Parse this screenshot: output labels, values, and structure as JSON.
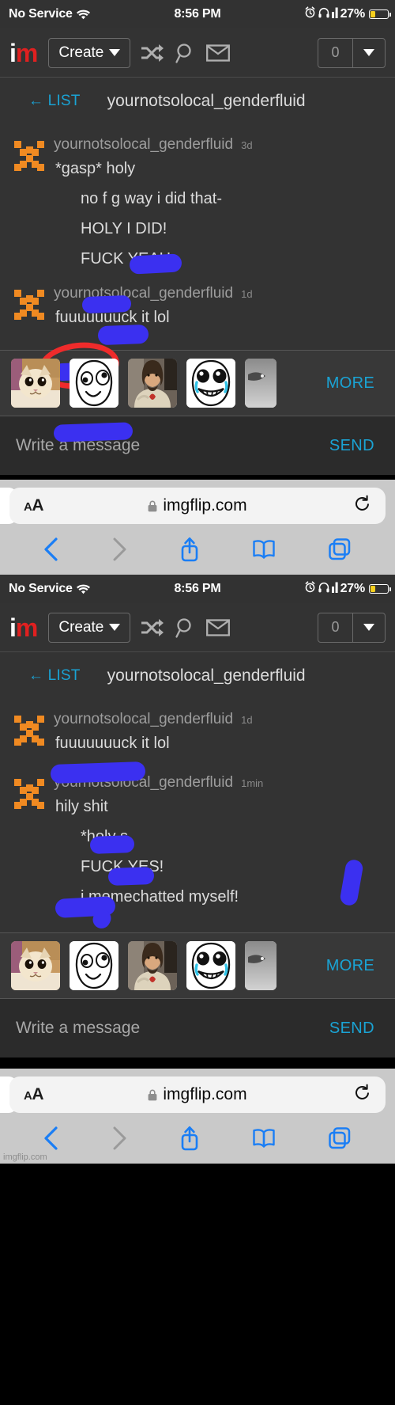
{
  "status_bar": {
    "carrier": "No Service",
    "wifi_icon": "wifi-icon",
    "time": "8:56 PM",
    "alarm_icon": "alarm-clock-icon",
    "headphones_icon": "headphones-icon",
    "signal_icon": "signal-bars-icon",
    "battery_percent": "27%",
    "battery_fill_ratio": 0.27,
    "battery_color": "#f5cf1e"
  },
  "site_nav": {
    "logo_first": "i",
    "logo_second": "m",
    "logo_color_first": "#ffffff",
    "logo_color_second": "#e02020",
    "create_label": "Create",
    "shuffle_icon": "shuffle-icon",
    "search_icon": "search-icon",
    "mail_icon": "envelope-icon",
    "notification_count": "0",
    "dropdown_icon": "chevron-down-icon"
  },
  "chat": {
    "back_label": "← LIST",
    "title": "yournotsolocal_genderfluid",
    "accent_link": "#1aa3d4",
    "avatar_color": "#f08a22",
    "censor_color": "#3b30f0",
    "annotation_color": "#ef2b2b"
  },
  "panel_one": {
    "groups": [
      {
        "user": "yournotsolocal_genderfluid",
        "time": "3d",
        "lines": [
          {
            "text": "*gasp* holy",
            "indent": false,
            "censored": true
          },
          {
            "text": "no f        g way i did that-",
            "indent": true,
            "censored": true
          },
          {
            "text": "HOLY         I DID!",
            "indent": true,
            "censored": true
          },
          {
            "text": "FUCK YEAH",
            "indent": true,
            "censored": true,
            "circled": true
          }
        ]
      },
      {
        "user": "yournotsolocal_genderfluid",
        "time": "1d",
        "lines": [
          {
            "text": "fuuuuuuuck it lol",
            "indent": false,
            "censored": true
          }
        ]
      }
    ]
  },
  "panel_two": {
    "groups": [
      {
        "user": "yournotsolocal_genderfluid",
        "time": "1d",
        "lines": [
          {
            "text": "fuuuuuuuck it lol",
            "indent": false,
            "censored": true
          }
        ]
      },
      {
        "user": "yournotsolocal_genderfluid",
        "time": "1min",
        "lines": [
          {
            "text": "hily shit",
            "indent": false,
            "censored": true
          },
          {
            "text": "*holy s",
            "indent": true,
            "censored": true
          },
          {
            "text": "FUCK YES!",
            "indent": true,
            "censored": true
          },
          {
            "text": "i memechatted myself!",
            "indent": true,
            "censored": false
          }
        ]
      }
    ]
  },
  "sticker_bar": {
    "more_label": "MORE",
    "stickers": [
      {
        "name": "sticker-happy-cat",
        "alt": "cat face meme"
      },
      {
        "name": "sticker-derp-rage-face",
        "alt": "derp rage face"
      },
      {
        "name": "sticker-buddy-jesus",
        "alt": "buddy christ pointing"
      },
      {
        "name": "sticker-happy-crying-rage-face",
        "alt": "happy crying rage face"
      },
      {
        "name": "sticker-gray-partial",
        "alt": "partially visible gray image"
      }
    ]
  },
  "compose": {
    "placeholder": "Write a message",
    "value": "",
    "send_label": "SEND"
  },
  "safari": {
    "text_size_label_small": "A",
    "text_size_label_big": "A",
    "lock_icon": "lock-icon",
    "url": "imgflip.com",
    "reload_icon": "reload-icon",
    "back_icon": "chevron-left-icon",
    "forward_icon": "chevron-right-icon",
    "share_icon": "share-icon",
    "bookmarks_icon": "book-icon",
    "tabs_icon": "tabs-icon",
    "back_enabled": true,
    "forward_enabled": false,
    "accent": "#1a7ef5"
  },
  "watermark": {
    "text": "imgflip.com"
  }
}
